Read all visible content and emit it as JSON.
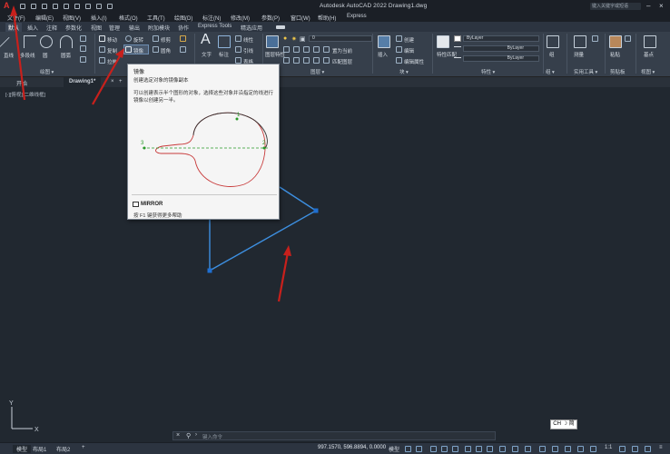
{
  "app": {
    "title": "Autodesk AutoCAD 2022    Drawing1.dwg",
    "search_placeholder": "键入关键字或短语",
    "app_button": "A"
  },
  "menu": [
    "文件(F)",
    "编辑(E)",
    "视图(V)",
    "插入(I)",
    "格式(O)",
    "工具(T)",
    "绘图(D)",
    "标注(N)",
    "修改(M)",
    "参数(P)",
    "窗口(W)",
    "帮助(H)",
    "Express"
  ],
  "ribbon_tabs": [
    "默认",
    "插入",
    "注释",
    "参数化",
    "视图",
    "管理",
    "输出",
    "附加模块",
    "协作",
    "Express Tools",
    "精选应用"
  ],
  "ribbon": {
    "draw_tools": [
      "直线",
      "多段线",
      "圆",
      "圆弧"
    ],
    "modify_tools": [
      "移动",
      "旋转",
      "修剪",
      "复制",
      "镜像",
      "圆角",
      "拉伸"
    ],
    "text": "文字",
    "dimension": "标注",
    "linear": "线性",
    "leader": "引线",
    "table": "表格",
    "layer_value": "0",
    "layer_tools": [
      "置为当前",
      "匹配图层"
    ],
    "layer_properties": "图层特性",
    "insert": "插入",
    "block_tools": [
      "创建",
      "编辑",
      "编辑属性"
    ],
    "properties_match": "特性匹配",
    "bylayer": [
      "ByLayer",
      "ByLayer",
      "ByLayer"
    ],
    "group": "组",
    "measure": "测量",
    "paste": "粘贴",
    "base": "基点",
    "panels": {
      "draw": "绘图 ▾",
      "layers": "图层 ▾",
      "block": "块 ▾",
      "properties": "特性 ▾",
      "groups": "组 ▾",
      "utilities": "实用工具 ▾",
      "clipboard": "剪贴板",
      "view": "视图 ▾"
    }
  },
  "file_tabs": [
    "开始",
    "Drawing1*",
    "+"
  ],
  "viewport_label": "[-][俯视][二维线框]",
  "tooltip": {
    "title": "镜像",
    "subtitle": "创建选定对象的镜像副本",
    "description": "可以创建表示半个图形的对象，选择这些对象并沿指定的线进行镜像以创建另一半。",
    "labels": [
      "1",
      "2",
      "3"
    ],
    "command": "MIRROR",
    "help": "按 F1 键获得更多帮助"
  },
  "command_line": {
    "placeholder": "键入命令"
  },
  "ucs": {
    "x": "X",
    "y": "Y"
  },
  "ime": "CH ☽ 简",
  "status": {
    "layouts": [
      "模型",
      "布局1",
      "布局2",
      "+"
    ],
    "coords": "997.1570, 596.8894, 0.0000",
    "model_label": "模型",
    "scale": "1:1"
  },
  "colors": {
    "canvas": "#212830",
    "ribbon": "#363f4b",
    "selection": "#3d8fe0",
    "arrow": "#c8201c",
    "grip": "#1f6fd1"
  }
}
